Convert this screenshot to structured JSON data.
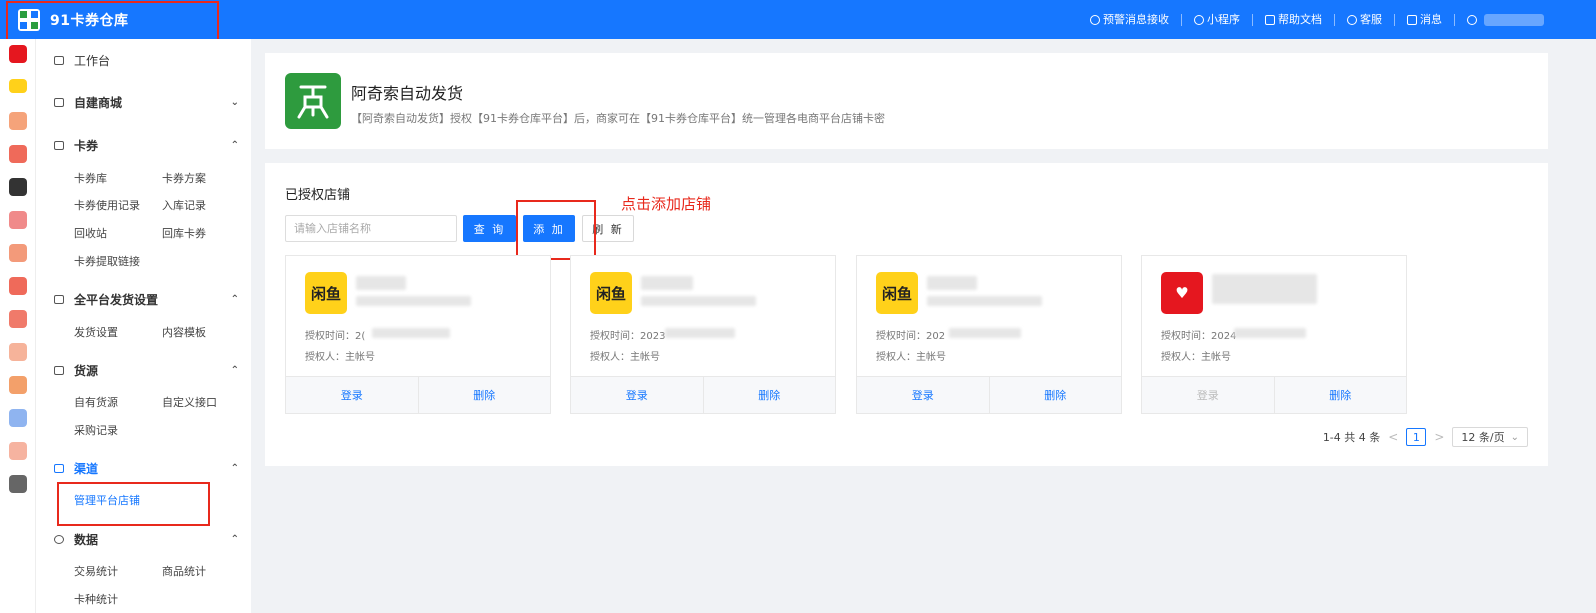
{
  "header": {
    "brand_title": "91卡券仓库",
    "nav": [
      {
        "label": "预警消息接收",
        "icon": "bell-icon"
      },
      {
        "label": "小程序",
        "icon": "mini-program-icon"
      },
      {
        "label": "帮助文档",
        "icon": "document-icon"
      },
      {
        "label": "客服",
        "icon": "headset-icon"
      },
      {
        "label": "消息",
        "icon": "mail-icon"
      }
    ],
    "user_icon": "user-icon"
  },
  "rail": {
    "icons": [
      {
        "name": "pdd-icon",
        "color": "#e5171f"
      },
      {
        "name": "xianyu-icon",
        "color": "#ffd11a"
      },
      {
        "name": "taobao-icon",
        "color": "#f5a37a"
      },
      {
        "name": "shop-icon",
        "color": "#ef6a5a"
      },
      {
        "name": "douyin-icon",
        "color": "#333333"
      },
      {
        "name": "coupon-icon",
        "color": "#f08a8a"
      },
      {
        "name": "grid-icon",
        "color": "#f39a7a"
      },
      {
        "name": "like-icon",
        "color": "#ef6a5a"
      },
      {
        "name": "store-icon",
        "color": "#f07a6a"
      },
      {
        "name": "home-icon",
        "color": "#f6b39a"
      },
      {
        "name": "book-icon",
        "color": "#f3a06a"
      },
      {
        "name": "link-icon",
        "color": "#8fb4f0"
      },
      {
        "name": "house-icon",
        "color": "#f6b3a0"
      },
      {
        "name": "pay-icon",
        "color": "#666666"
      }
    ]
  },
  "sidebar": {
    "workbench": "工作台",
    "groups": [
      {
        "label": "自建商城",
        "chevron": "⌄"
      },
      {
        "label": "卡券",
        "chevron": "⌃"
      },
      {
        "label": "全平台发货设置",
        "chevron": "⌃"
      },
      {
        "label": "货源",
        "chevron": "⌃"
      },
      {
        "label": "渠道",
        "chevron": "⌃"
      },
      {
        "label": "数据",
        "chevron": "⌃"
      }
    ],
    "card_items": [
      "卡券库",
      "卡券方案",
      "卡券使用记录",
      "入库记录",
      "回收站",
      "回库卡券",
      "卡券提取链接"
    ],
    "delivery_items": [
      "发货设置",
      "内容模板"
    ],
    "supply_items": [
      "自有货源",
      "自定义接口",
      "采购记录"
    ],
    "channel_items": [
      "管理平台店铺"
    ],
    "data_items": [
      "交易统计",
      "商品统计",
      "卡种统计"
    ]
  },
  "app": {
    "title": "阿奇索自动发货",
    "description": "【阿奇索自动发货】授权【91卡券仓库平台】后，商家可在【91卡券仓库平台】统一管理各电商平台店铺卡密"
  },
  "shops_section": {
    "title": "已授权店铺",
    "search_placeholder": "请输入店铺名称",
    "query_label": "查 询",
    "add_label": "添 加",
    "refresh_label": "刷 新",
    "annotation": "点击添加店铺"
  },
  "shops": [
    {
      "logo": "xianyu",
      "logo_text": "闲鱼",
      "auth_time_label": "授权时间：",
      "auth_time": "2(",
      "auth_by": "授权人：主帐号",
      "login": "登录",
      "delete": "删除",
      "login_disabled": false
    },
    {
      "logo": "xianyu",
      "logo_text": "闲鱼",
      "auth_time_label": "授权时间：",
      "auth_time": "2023",
      "auth_by": "授权人：主帐号",
      "login": "登录",
      "delete": "删除",
      "login_disabled": false
    },
    {
      "logo": "xianyu",
      "logo_text": "闲鱼",
      "auth_time_label": "授权时间：",
      "auth_time": "202",
      "auth_by": "授权人：主帐号",
      "login": "登录",
      "delete": "删除",
      "login_disabled": false
    },
    {
      "logo": "pdd",
      "logo_text": "♥",
      "auth_time_label": "授权时间：",
      "auth_time": "2024",
      "auth_by": "授权人：主帐号",
      "login": "登录",
      "delete": "删除",
      "login_disabled": true
    }
  ],
  "pagination": {
    "summary": "1-4 共 4 条",
    "current_page": "1",
    "page_size": "12 条/页",
    "prev": "<",
    "next": ">",
    "dropdown": "⌄"
  }
}
